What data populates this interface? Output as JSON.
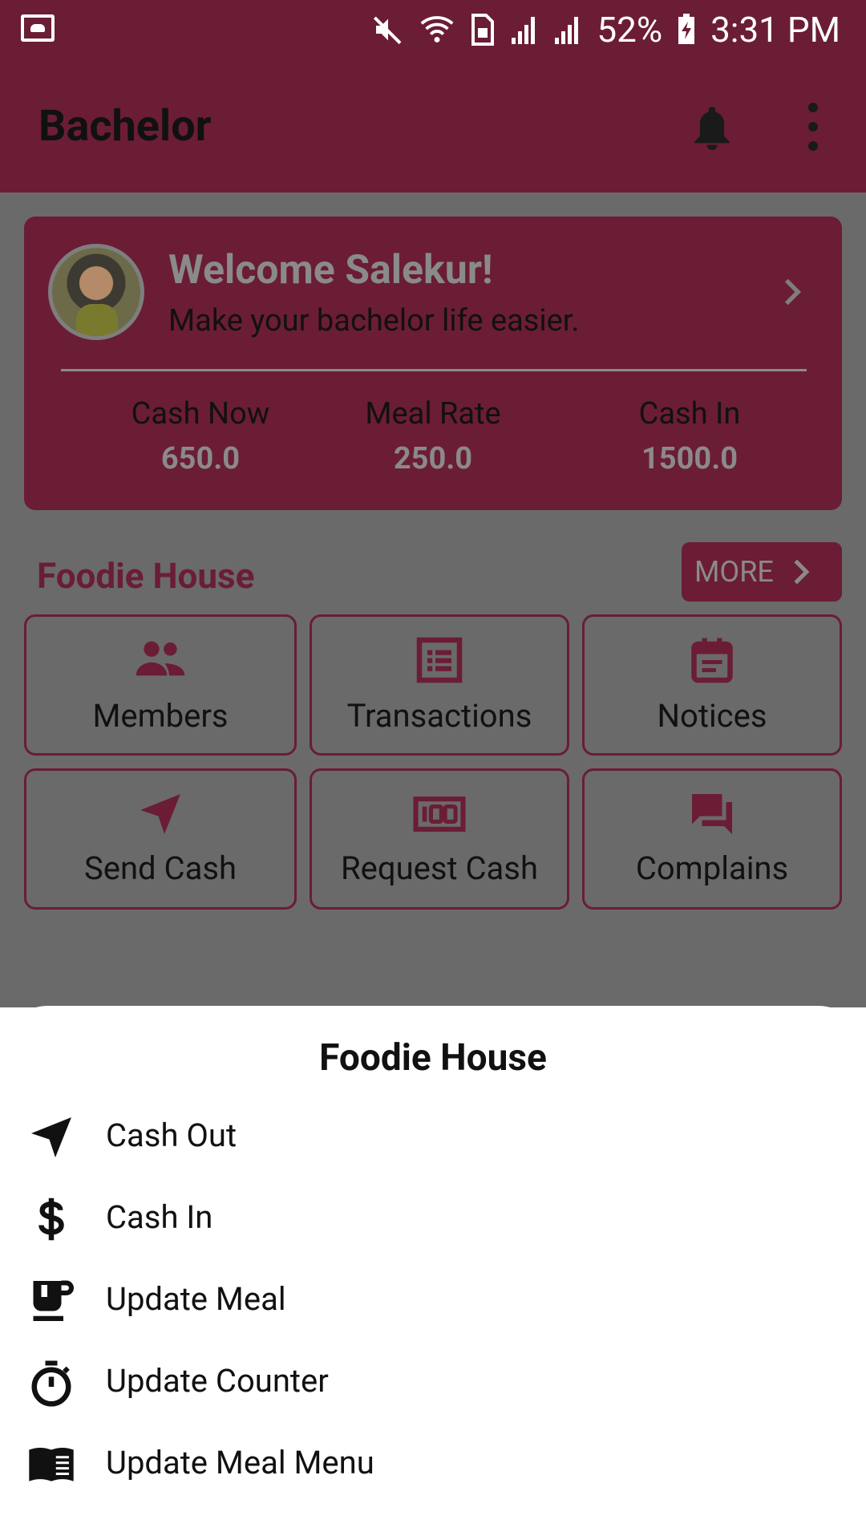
{
  "status_bar": {
    "battery": "52%",
    "time": "3:31 PM"
  },
  "app_bar": {
    "title": "Bachelor"
  },
  "profile_card": {
    "welcome": "Welcome Salekur!",
    "subtitle": "Make your bachelor life easier.",
    "stats": [
      {
        "label": "Cash Now",
        "value": "650.0"
      },
      {
        "label": "Meal Rate",
        "value": "250.0"
      },
      {
        "label": "Cash In",
        "value": "1500.0"
      }
    ]
  },
  "house": {
    "name": "Foodie House",
    "more_label": "MORE",
    "tiles": [
      {
        "label": "Members",
        "icon": "people-icon"
      },
      {
        "label": "Transactions",
        "icon": "list-icon"
      },
      {
        "label": "Notices",
        "icon": "calendar-icon"
      },
      {
        "label": "Send Cash",
        "icon": "send-icon"
      },
      {
        "label": "Request Cash",
        "icon": "money-icon"
      },
      {
        "label": "Complains",
        "icon": "chat-icon"
      }
    ]
  },
  "sheet": {
    "title": "Foodie House",
    "items": [
      {
        "label": "Cash Out",
        "icon": "send-icon"
      },
      {
        "label": "Cash In",
        "icon": "dollar-icon"
      },
      {
        "label": "Update Meal",
        "icon": "cup-icon"
      },
      {
        "label": "Update Counter",
        "icon": "timer-icon"
      },
      {
        "label": "Update Meal Menu",
        "icon": "book-icon"
      }
    ]
  },
  "colors": {
    "primary": "#6b1d35",
    "scrim": "#6a6a6a",
    "sheet": "#ffffff"
  }
}
